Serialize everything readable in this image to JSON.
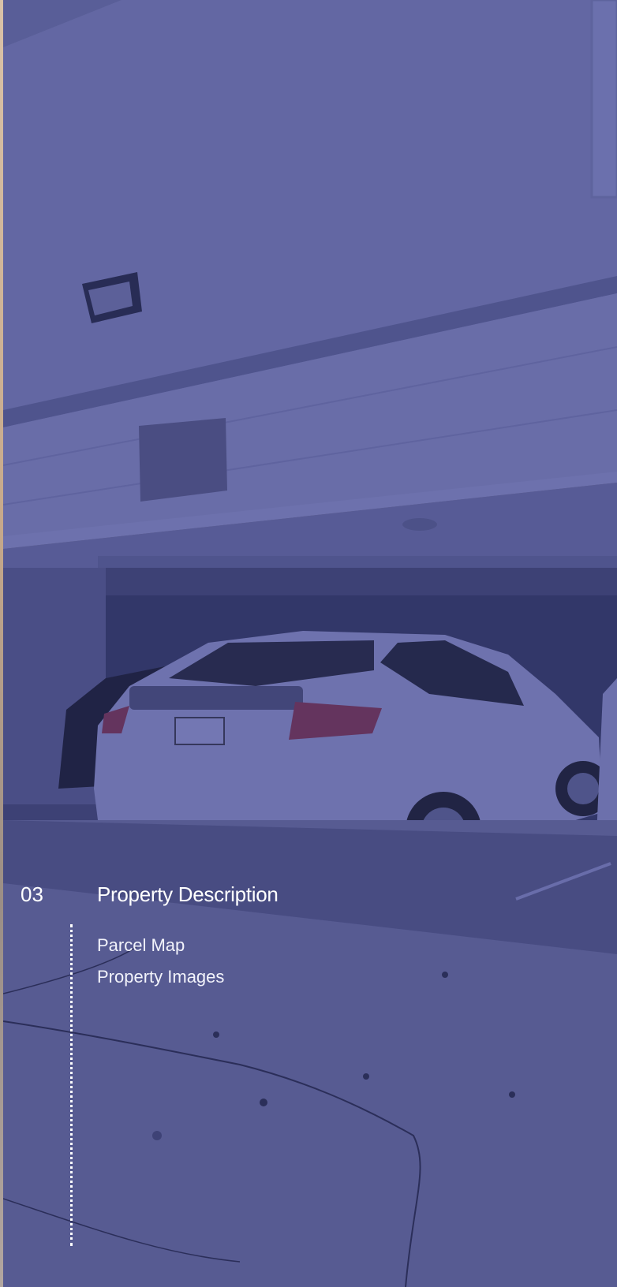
{
  "section": {
    "number": "03",
    "title": "Property Description",
    "items": [
      {
        "label": "Parcel Map"
      },
      {
        "label": "Property Images"
      }
    ]
  },
  "background": {
    "photo": "carport-with-parked-white-car",
    "overlay_color": "#34388a"
  }
}
